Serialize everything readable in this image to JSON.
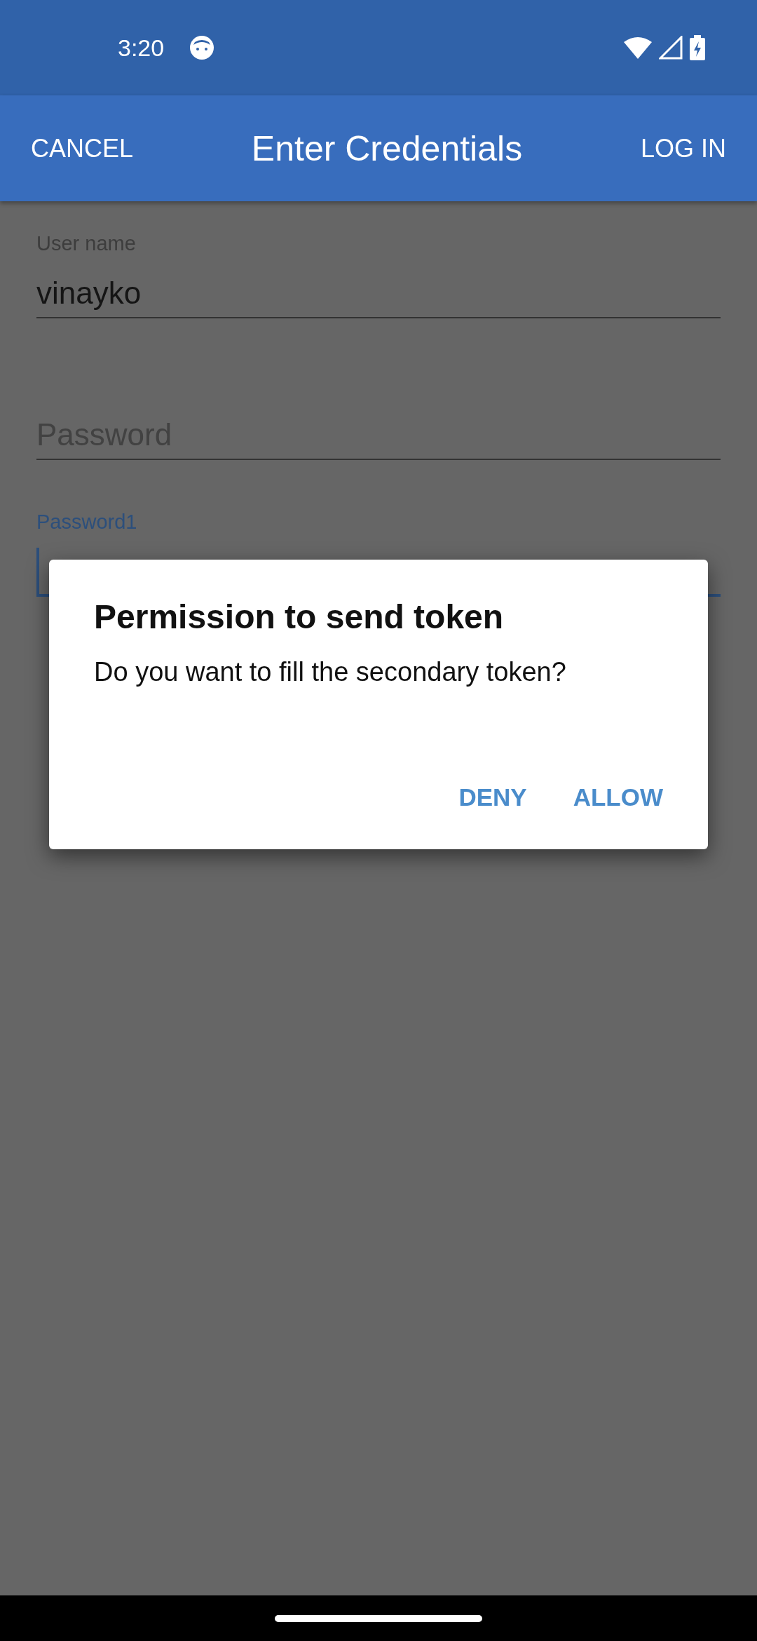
{
  "status_bar": {
    "time": "3:20"
  },
  "app_bar": {
    "cancel": "CANCEL",
    "title": "Enter Credentials",
    "login": "LOG IN"
  },
  "fields": [
    {
      "label": "User name",
      "value": "vinayko",
      "focused": false
    },
    {
      "placeholder": "Password",
      "focused": false
    },
    {
      "label": "Password1",
      "focused": true
    }
  ],
  "dialog": {
    "title": "Permission to send token",
    "message": "Do you want to fill the secondary token?",
    "buttons": [
      "DENY",
      "ALLOW"
    ]
  }
}
